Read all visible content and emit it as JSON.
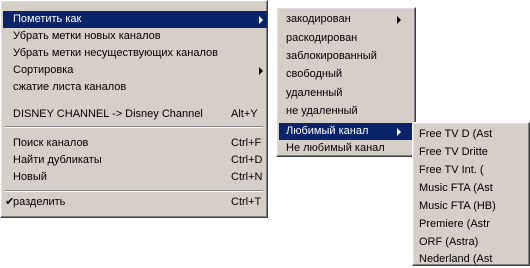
{
  "main_menu": {
    "items": [
      {
        "label": "Пометить как",
        "shortcut": "",
        "submenu": true,
        "selected": true
      },
      {
        "label": "Убрать метки новых каналов",
        "shortcut": "",
        "submenu": false
      },
      {
        "label": "Убрать метки несуществующих каналов",
        "shortcut": "",
        "submenu": false
      },
      {
        "label": "Сортировка",
        "shortcut": "",
        "submenu": true
      },
      {
        "label": "сжатие листа каналов",
        "shortcut": "",
        "submenu": false
      },
      {
        "label": "DISNEY CHANNEL -> Disney Channel",
        "shortcut": "Alt+Y",
        "submenu": false
      },
      {
        "label": "Поиск каналов",
        "shortcut": "Ctrl+F",
        "submenu": false
      },
      {
        "label": "Найти дубликаты",
        "shortcut": "Ctrl+D",
        "submenu": false
      },
      {
        "label": "Новый",
        "shortcut": "Ctrl+N",
        "submenu": false
      },
      {
        "label": "разделить",
        "shortcut": "Ctrl+T",
        "submenu": false,
        "checked": true,
        "check_mark": "✔"
      }
    ]
  },
  "mark_submenu": {
    "items": [
      {
        "label": "закодирован",
        "submenu": true
      },
      {
        "label": "раскодирован",
        "submenu": false
      },
      {
        "label": "заблокированный",
        "submenu": false
      },
      {
        "label": "свободный",
        "submenu": false
      },
      {
        "label": "удаленный",
        "submenu": false
      },
      {
        "label": "не удаленный",
        "submenu": false
      },
      {
        "label": "Любимый канал",
        "submenu": true,
        "selected": true
      },
      {
        "label": "Не любимый канал",
        "submenu": false
      }
    ]
  },
  "favorite_submenu": {
    "items": [
      {
        "label": "Free TV D (Ast"
      },
      {
        "label": "Free TV Dritte"
      },
      {
        "label": "Free TV Int. ("
      },
      {
        "label": "Music FTA (Ast"
      },
      {
        "label": "Music FTA (HB)"
      },
      {
        "label": "Premiere (Astr"
      },
      {
        "label": "ORF (Astra)"
      },
      {
        "label": "Nederland (Ast"
      }
    ]
  },
  "colors": {
    "menu_bg": "#d4d0c8",
    "highlight": "#0a246a",
    "highlight_text": "#ffffff"
  }
}
